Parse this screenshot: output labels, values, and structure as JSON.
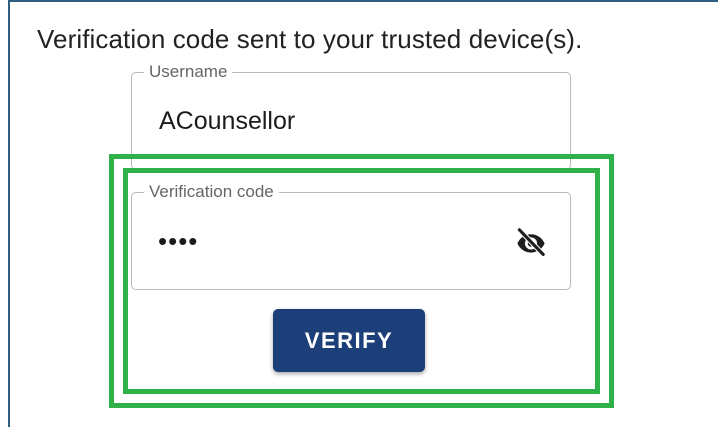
{
  "message": "Verification code sent to your trusted device(s).",
  "username_field": {
    "label": "Username",
    "value": "ACounsellor"
  },
  "code_field": {
    "label": "Verification code",
    "masked_value": "••••",
    "toggle_icon": "eye-off-icon"
  },
  "verify_button": {
    "label": "VERIFY"
  },
  "colors": {
    "highlight": "#2fb14a",
    "primary_button": "#1c3f7a",
    "panel_border": "#2f5f7f"
  }
}
